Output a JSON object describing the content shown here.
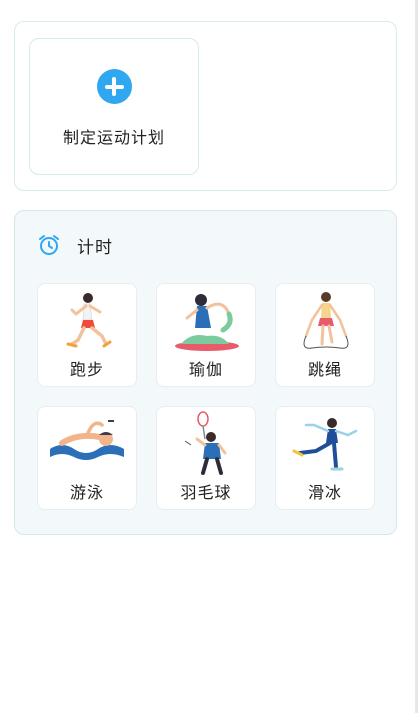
{
  "plan": {
    "icon": "plus-circle-icon",
    "label": "制定运动计划",
    "accent_color": "#2fa7f1"
  },
  "timer": {
    "icon": "alarm-clock-icon",
    "title": "计时",
    "activities": [
      {
        "label": "跑步",
        "icon": "running-icon"
      },
      {
        "label": "瑜伽",
        "icon": "yoga-icon"
      },
      {
        "label": "跳绳",
        "icon": "jump-rope-icon"
      },
      {
        "label": "游泳",
        "icon": "swimming-icon"
      },
      {
        "label": "羽毛球",
        "icon": "badminton-icon"
      },
      {
        "label": "滑冰",
        "icon": "skating-icon"
      }
    ]
  }
}
